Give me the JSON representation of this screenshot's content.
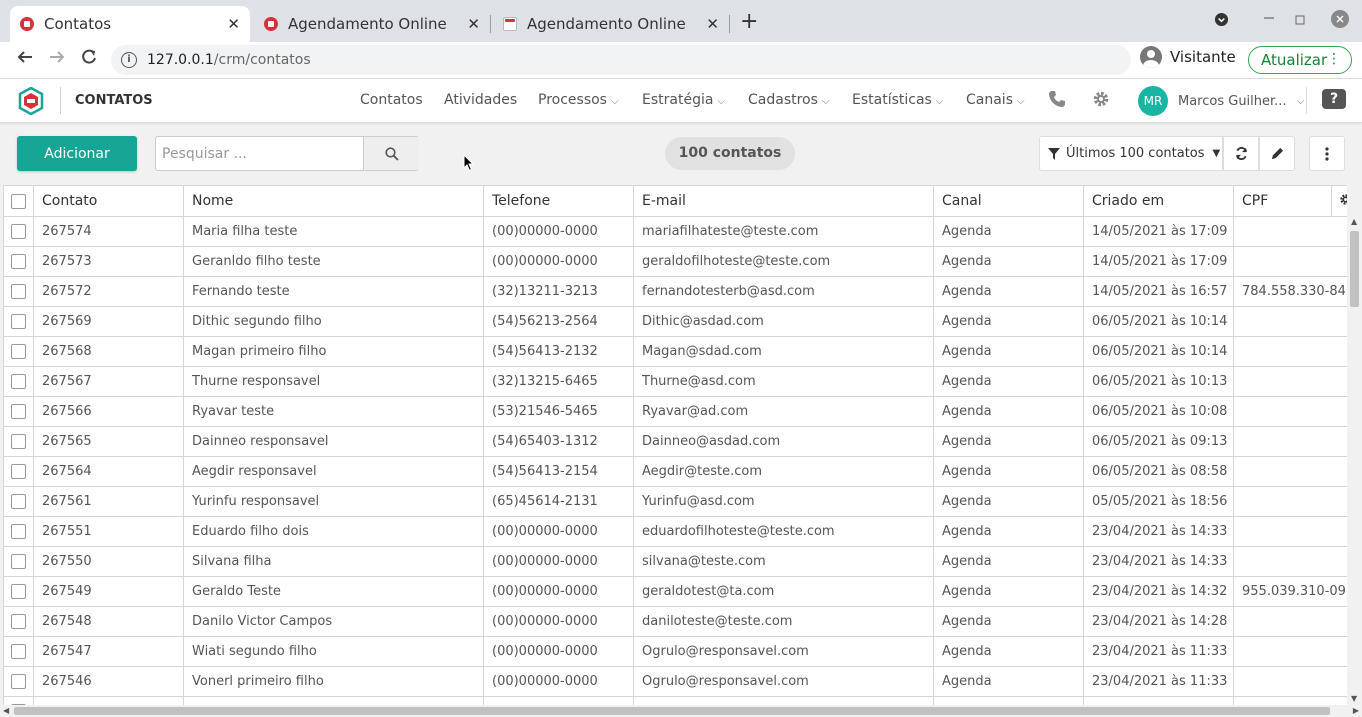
{
  "browser": {
    "tabs": [
      {
        "title": "Contatos",
        "active": true
      },
      {
        "title": "Agendamento Online",
        "active": false
      },
      {
        "title": "Agendamento Online",
        "active": false
      }
    ],
    "url_host": "127.0.0.1",
    "url_path": "/crm/contatos",
    "profile_label": "Visitante",
    "update_label": "Atualizar"
  },
  "app": {
    "section_title": "CONTATOS",
    "menu": [
      {
        "label": "Contatos",
        "dropdown": false
      },
      {
        "label": "Atividades",
        "dropdown": false
      },
      {
        "label": "Processos",
        "dropdown": true
      },
      {
        "label": "Estratégia",
        "dropdown": true
      },
      {
        "label": "Cadastros",
        "dropdown": true
      },
      {
        "label": "Estatísticas",
        "dropdown": true
      },
      {
        "label": "Canais",
        "dropdown": true
      }
    ],
    "user_initials": "MR",
    "user_name": "Marcos Guilher...",
    "help_icon": "question-icon",
    "accent_color": "#17a596"
  },
  "toolbar": {
    "add_label": "Adicionar",
    "search_placeholder": "Pesquisar ...",
    "count_label": "100 contatos",
    "filter_label": "Últimos 100 contatos"
  },
  "table": {
    "columns": [
      "Contato",
      "Nome",
      "Telefone",
      "E-mail",
      "Canal",
      "Criado em",
      "CPF"
    ],
    "rows": [
      [
        "267574",
        "Maria filha teste",
        "(00)00000-0000",
        "mariafilhateste@teste.com",
        "Agenda",
        "14/05/2021 às 17:09",
        ""
      ],
      [
        "267573",
        "Geranldo filho teste",
        "(00)00000-0000",
        "geraldofilhoteste@teste.com",
        "Agenda",
        "14/05/2021 às 17:09",
        ""
      ],
      [
        "267572",
        "Fernando teste",
        "(32)13211-3213",
        "fernandotesterb@asd.com",
        "Agenda",
        "14/05/2021 às 16:57",
        "784.558.330-84"
      ],
      [
        "267569",
        "Dithic segundo filho",
        "(54)56213-2564",
        "Dithic@asdad.com",
        "Agenda",
        "06/05/2021 às 10:14",
        ""
      ],
      [
        "267568",
        "Magan primeiro filho",
        "(54)56413-2132",
        "Magan@sdad.com",
        "Agenda",
        "06/05/2021 às 10:14",
        ""
      ],
      [
        "267567",
        "Thurne responsavel",
        "(32)13215-6465",
        "Thurne@asd.com",
        "Agenda",
        "06/05/2021 às 10:13",
        ""
      ],
      [
        "267566",
        "Ryavar teste",
        "(53)21546-5465",
        "Ryavar@ad.com",
        "Agenda",
        "06/05/2021 às 10:08",
        ""
      ],
      [
        "267565",
        "Dainneo responsavel",
        "(54)65403-1312",
        "Dainneo@asdad.com",
        "Agenda",
        "06/05/2021 às 09:13",
        ""
      ],
      [
        "267564",
        "Aegdir responsavel",
        "(54)56413-2154",
        "Aegdir@teste.com",
        "Agenda",
        "06/05/2021 às 08:58",
        ""
      ],
      [
        "267561",
        "Yurinfu responsavel",
        "(65)45614-2131",
        "Yurinfu@asd.com",
        "Agenda",
        "05/05/2021 às 18:56",
        ""
      ],
      [
        "267551",
        "Eduardo filho dois",
        "(00)00000-0000",
        "eduardofilhoteste@teste.com",
        "Agenda",
        "23/04/2021 às 14:33",
        ""
      ],
      [
        "267550",
        "Silvana filha",
        "(00)00000-0000",
        "silvana@teste.com",
        "Agenda",
        "23/04/2021 às 14:33",
        ""
      ],
      [
        "267549",
        "Geraldo Teste",
        "(00)00000-0000",
        "geraldotest@ta.com",
        "Agenda",
        "23/04/2021 às 14:32",
        "955.039.310-09"
      ],
      [
        "267548",
        "Danilo Victor Campos",
        "(00)00000-0000",
        "daniloteste@teste.com",
        "Agenda",
        "23/04/2021 às 14:28",
        ""
      ],
      [
        "267547",
        "Wiati segundo filho",
        "(00)00000-0000",
        "Ogrulo@responsavel.com",
        "Agenda",
        "23/04/2021 às 11:33",
        ""
      ],
      [
        "267546",
        "Vonerl primeiro filho",
        "(00)00000-0000",
        "Ogrulo@responsavel.com",
        "Agenda",
        "23/04/2021 às 11:33",
        ""
      ],
      [
        "",
        "",
        "",
        "",
        "",
        "",
        ""
      ]
    ]
  }
}
